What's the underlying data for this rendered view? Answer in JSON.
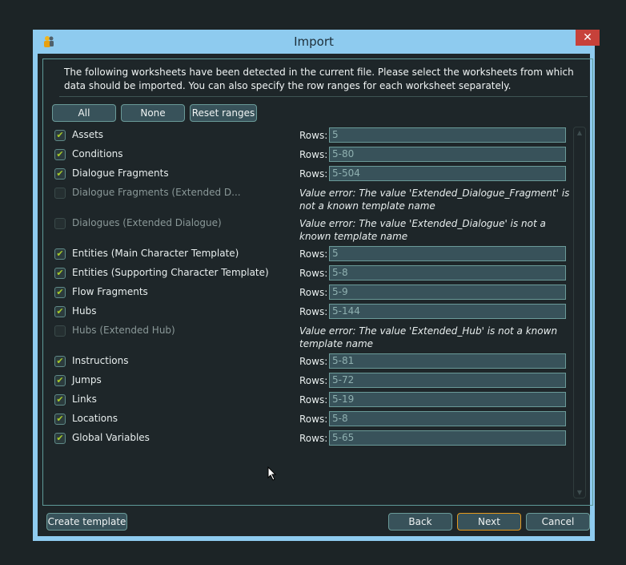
{
  "window": {
    "title": "Import",
    "close_icon": "close-icon",
    "app_icon": "app-icon"
  },
  "intro": "The following worksheets have been detected in the current file. Please select the worksheets from which data should be imported. You can also specify the row ranges for each worksheet separately.",
  "toolbar": {
    "all": "All",
    "none": "None",
    "reset": "Reset ranges"
  },
  "rows_label": "Rows:",
  "worksheets": [
    {
      "name": "Assets",
      "checked": true,
      "rows": "5"
    },
    {
      "name": "Conditions",
      "checked": true,
      "rows": "5-80"
    },
    {
      "name": "Dialogue Fragments",
      "checked": true,
      "rows": "5-504"
    },
    {
      "name": "Dialogue Fragments (Extended D...",
      "checked": false,
      "error": "Value error: The value 'Extended_Dialogue_Fragment' is not a known template name"
    },
    {
      "name": "Dialogues (Extended Dialogue)",
      "checked": false,
      "error": "Value error: The value 'Extended_Dialogue' is not a known template name"
    },
    {
      "name": "Entities (Main Character Template)",
      "checked": true,
      "rows": "5"
    },
    {
      "name": "Entities (Supporting Character Template)",
      "checked": true,
      "rows": "5-8"
    },
    {
      "name": "Flow Fragments",
      "checked": true,
      "rows": "5-9"
    },
    {
      "name": "Hubs",
      "checked": true,
      "rows": "5-144"
    },
    {
      "name": "Hubs (Extended Hub)",
      "checked": false,
      "error": "Value error: The value 'Extended_Hub' is not a known template name"
    },
    {
      "name": "Instructions",
      "checked": true,
      "rows": "5-81"
    },
    {
      "name": "Jumps",
      "checked": true,
      "rows": "5-72"
    },
    {
      "name": "Links",
      "checked": true,
      "rows": "5-19"
    },
    {
      "name": "Locations",
      "checked": true,
      "rows": "5-8"
    },
    {
      "name": "Global Variables",
      "checked": true,
      "rows": "5-65"
    }
  ],
  "footer": {
    "create_template": "Create template",
    "back": "Back",
    "next": "Next",
    "cancel": "Cancel"
  },
  "colors": {
    "titlebar": "#8ecbef",
    "background": "#1e2629",
    "check": "#a6c92a",
    "focus": "#e59a1d",
    "close": "#c7413a"
  }
}
